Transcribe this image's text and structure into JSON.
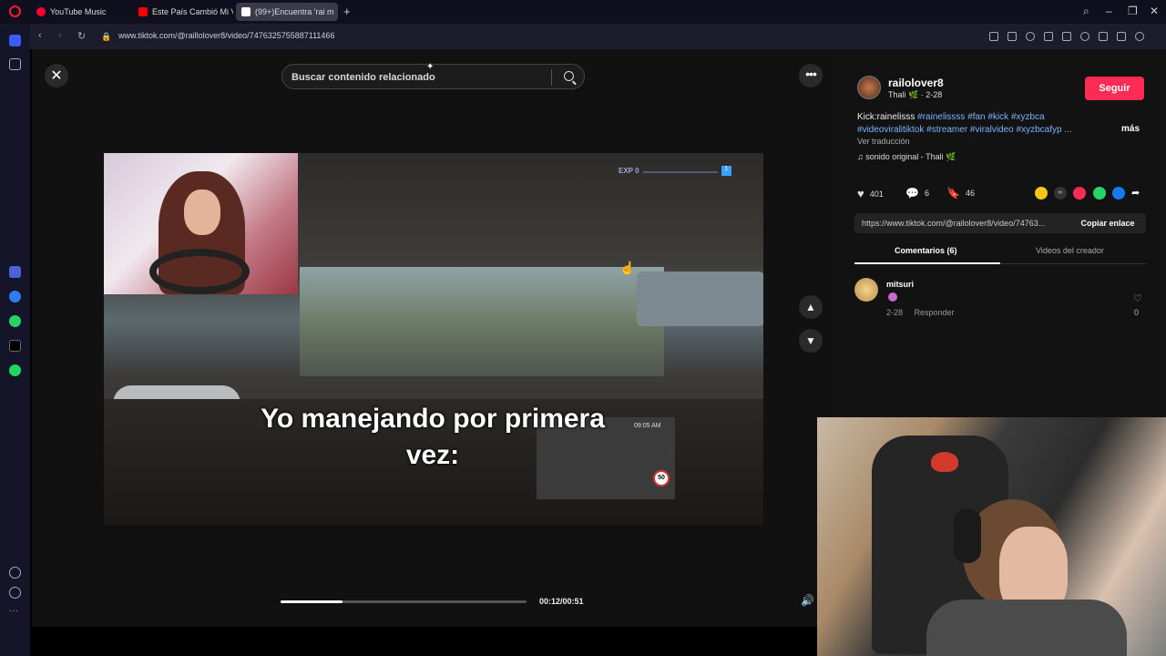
{
  "browser": {
    "tabs": [
      {
        "label": "YouTube Music",
        "icon": "youtube-music-icon",
        "color": "#ff0033"
      },
      {
        "label": "Este País Cambió Mi Vida",
        "icon": "youtube-icon",
        "color": "#ff0000"
      },
      {
        "label": "(99+)Encuentra 'rai m",
        "icon": "tiktok-icon",
        "color": "#ffffff"
      }
    ],
    "url": "www.tiktok.com/@raillolover8/video/7476325755887111466"
  },
  "search": {
    "placeholder": "Buscar contenido relacionado"
  },
  "video": {
    "caption_line1": "Yo manejando por primera",
    "caption_line2": "vez:",
    "hud_exp": "EXP 0",
    "hud_time": "09:05 AM",
    "hud_speed": "50",
    "time": "00:12/00:51",
    "progress": 0.25
  },
  "creator": {
    "username": "railolover8",
    "subline": "Thali 🌿 · 2-28",
    "follow_label": "Seguir",
    "description_prefix": "Kick:rainelisss ",
    "hashtags_line1": "#rainelissss #fan #kick #xyzbca",
    "hashtags_line2": "#videoviralitiktok #streamer #viralvideo #xyzbcafyp ...",
    "more_label": "más",
    "translate_label": "Ver traducción",
    "sound": "♫  sonido original - Thali 🌿"
  },
  "stats": {
    "likes": "401",
    "comments": "6",
    "saves": "46"
  },
  "share": {
    "link": "https://www.tiktok.com/@railolover8/video/74763...",
    "copy_label": "Copiar enlace"
  },
  "panel_tabs": {
    "comments": "Comentarios (6)",
    "creator_videos": "Videos del creador"
  },
  "comment": {
    "user": "mitsuri",
    "date": "2-28",
    "reply": "Responder",
    "likes": "0"
  },
  "colors": {
    "accent": "#fe2c55",
    "hashtag": "#7fb1ff"
  }
}
